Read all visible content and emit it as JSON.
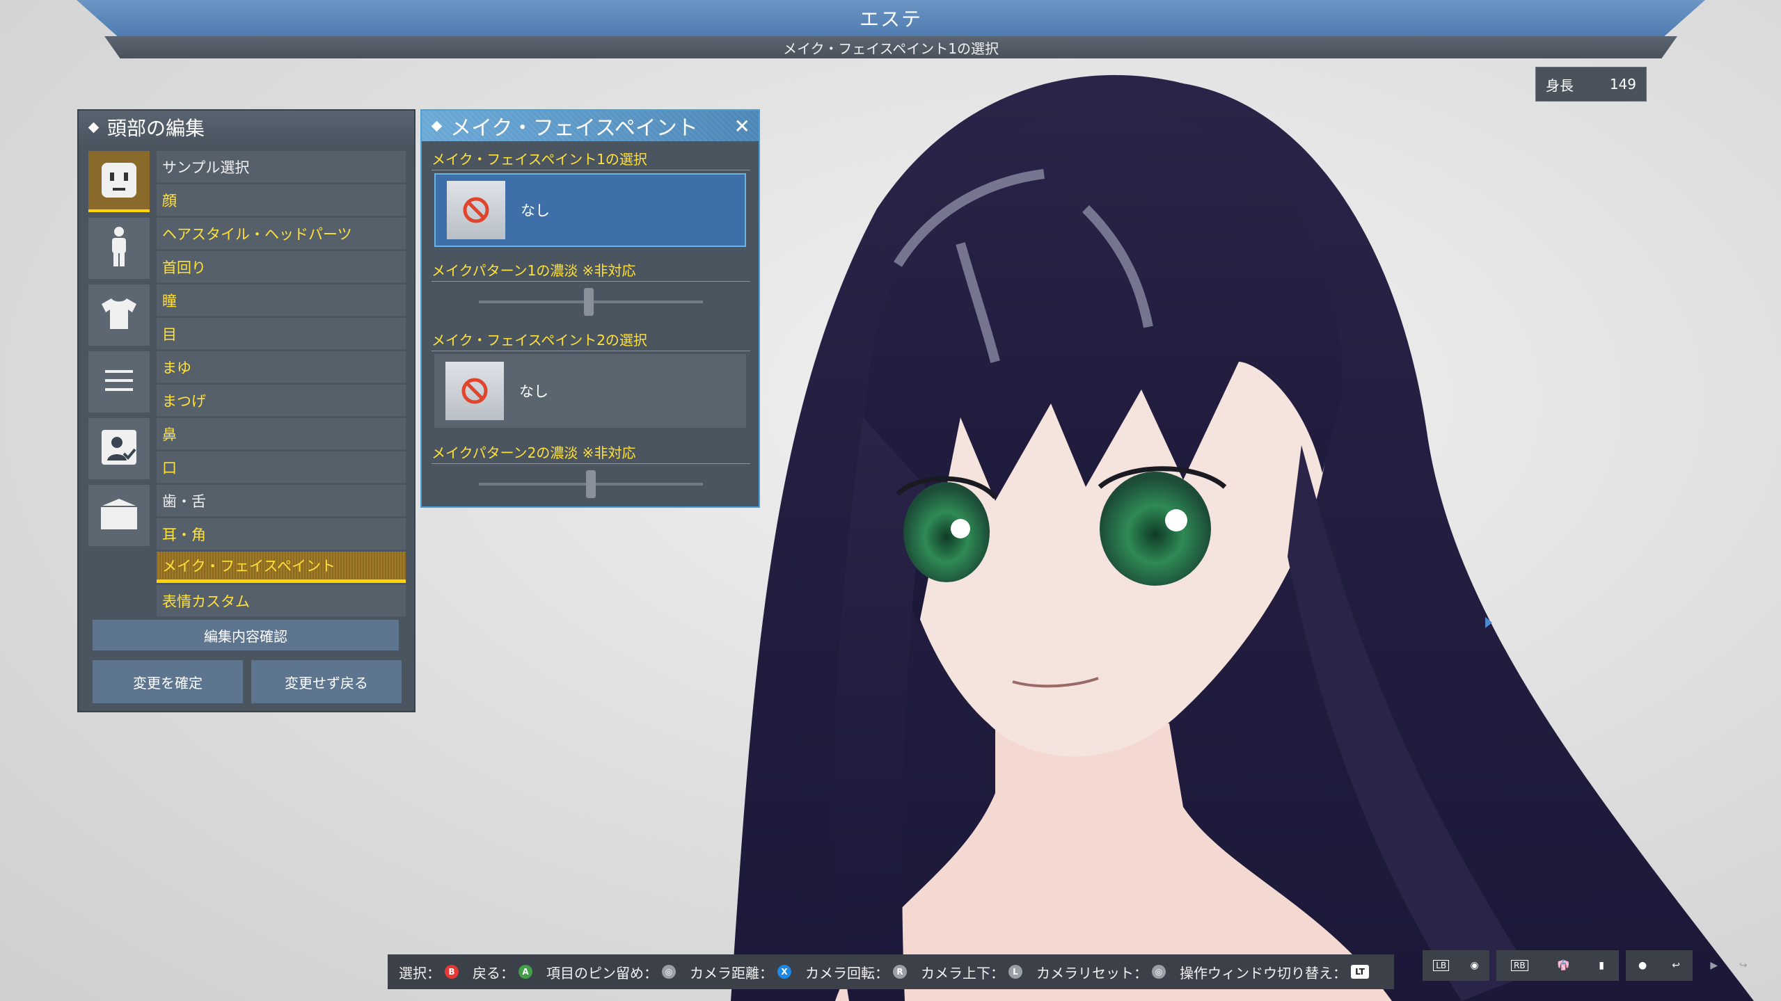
{
  "header": {
    "title": "エステ",
    "subtitle": "メイク・フェイスペイント1の選択"
  },
  "height_badge": {
    "label": "身長",
    "value": "149"
  },
  "head_panel": {
    "title": "頭部の編集",
    "category_icons": [
      "face-icon",
      "body-icon",
      "shirt-icon",
      "menu-lines-icon",
      "id-card-icon",
      "folder-icon"
    ],
    "items": [
      {
        "label": "サンプル選択"
      },
      {
        "label": "顔"
      },
      {
        "label": "ヘアスタイル・ヘッドパーツ"
      },
      {
        "label": "首回り"
      },
      {
        "label": "瞳"
      },
      {
        "label": "目"
      },
      {
        "label": "まゆ"
      },
      {
        "label": "まつげ"
      },
      {
        "label": "鼻"
      },
      {
        "label": "口"
      },
      {
        "label": "歯・舌"
      },
      {
        "label": "耳・角"
      },
      {
        "label": "メイク・フェイスペイント"
      },
      {
        "label": "表情カスタム"
      }
    ],
    "confirm_button": "編集内容確認",
    "apply_button": "変更を確定",
    "cancel_button": "変更せず戻る"
  },
  "make_panel": {
    "title": "メイク・フェイスペイント",
    "section1_label": "メイク・フェイスペイント1の選択",
    "section1_value": "なし",
    "slider1_label": "メイクパターン1の濃淡 ※非対応",
    "section2_label": "メイク・フェイスペイント2の選択",
    "section2_value": "なし",
    "slider2_label": "メイクパターン2の濃淡 ※非対応",
    "slider1_level": 0.49,
    "slider2_level": 0.5
  },
  "help_bar": {
    "items": [
      {
        "label": "選択：",
        "button": "B",
        "color": "#e53935"
      },
      {
        "label": "戻る：",
        "button": "A",
        "color": "#43a047"
      },
      {
        "label": "項目のピン留め：",
        "button": "◎",
        "color": "#9aa0a6"
      },
      {
        "label": "カメラ距離：",
        "button": "X",
        "color": "#1e88e5"
      },
      {
        "label": "カメラ回転：",
        "button": "R",
        "color": "#9aa0a6"
      },
      {
        "label": "カメラ上下：",
        "button": "L",
        "color": "#9aa0a6"
      },
      {
        "label": "カメラリセット：",
        "button": "◎",
        "color": "#9aa0a6"
      },
      {
        "label": "操作ウィンドウ切り替え：",
        "button": "LT",
        "color": "#ffffff"
      }
    ]
  },
  "hud": {
    "lb": "LB",
    "rb": "RB"
  }
}
